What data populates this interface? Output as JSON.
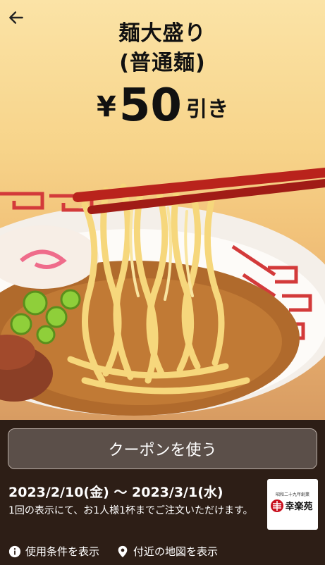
{
  "header": {
    "title_line1": "麺大盛り",
    "title_line2": "(普通麺)",
    "price_symbol": "¥",
    "price_amount": "50",
    "price_suffix": "引き"
  },
  "coupon": {
    "use_button": "クーポンを使う",
    "period": "2023/2/10(金) 〜 2023/3/1(水)",
    "note": "1回の表示にて、お1人様1杯までご注文いただけます。"
  },
  "logo": {
    "small_text": "昭和二十九年創業",
    "name": "幸楽苑"
  },
  "links": {
    "terms": "使用条件を表示",
    "map": "付近の地図を表示"
  },
  "icons": [
    "back-arrow-icon",
    "info-icon",
    "location-pin-icon"
  ],
  "colors": {
    "accent_red": "#c8101e",
    "panel_bg": "#2d1e16"
  }
}
